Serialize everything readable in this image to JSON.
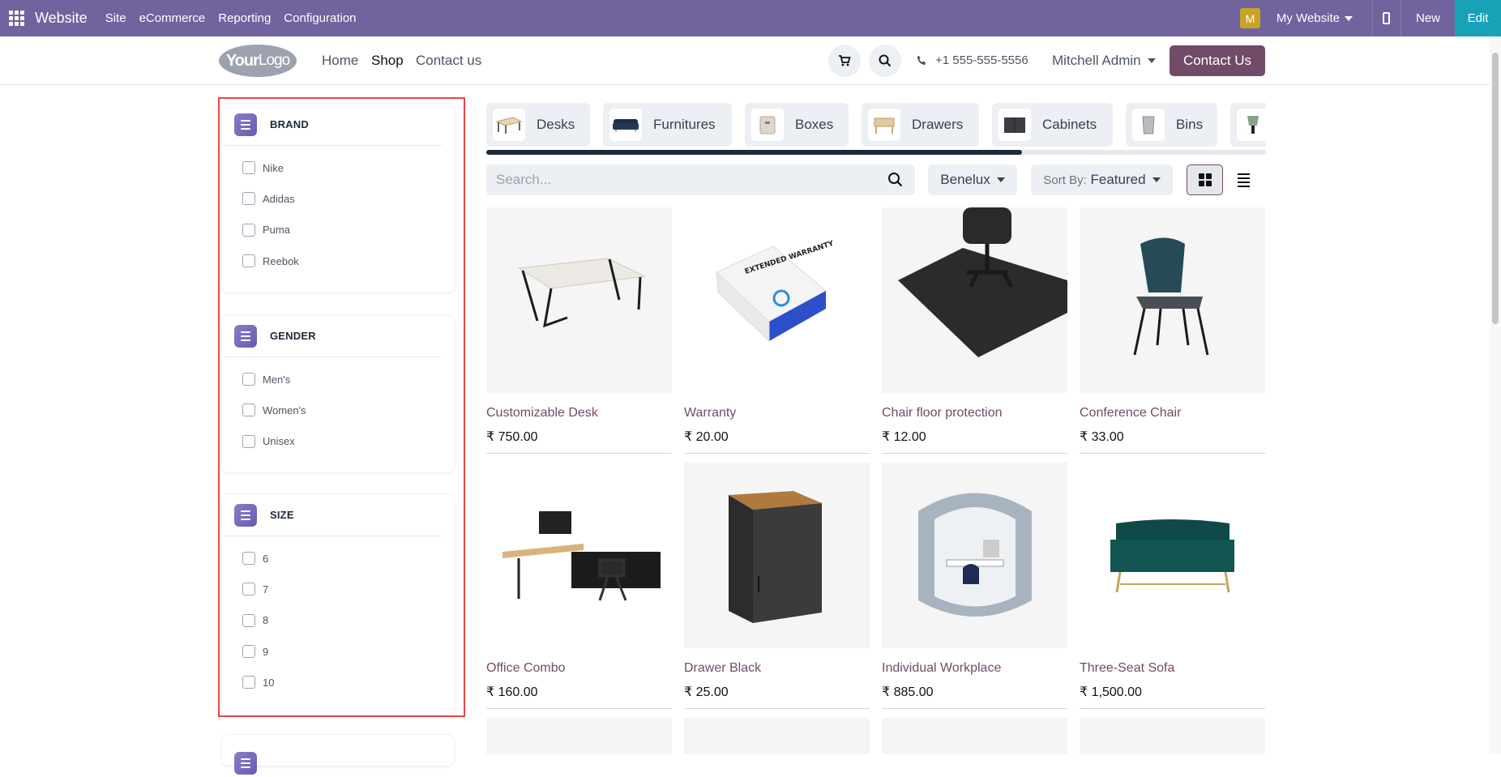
{
  "topbar": {
    "app_name": "Website",
    "menu": [
      "Site",
      "eCommerce",
      "Reporting",
      "Configuration"
    ],
    "avatar_letter": "M",
    "website_selector": "My Website",
    "new_label": "New",
    "edit_label": "Edit",
    "colors": {
      "bar": "#71639e",
      "edit": "#17a2b8"
    }
  },
  "header": {
    "logo_text": "Your",
    "logo_text2": "Logo",
    "nav": [
      "Home",
      "Shop",
      "Contact us"
    ],
    "phone": "+1 555-555-5556",
    "user": "Mitchell Admin",
    "contact_button": "Contact Us"
  },
  "filters": [
    {
      "title": "BRAND",
      "options": [
        "Nike",
        "Adidas",
        "Puma",
        "Reebok"
      ]
    },
    {
      "title": "GENDER",
      "options": [
        "Men's",
        "Women's",
        "Unisex"
      ]
    },
    {
      "title": "SIZE",
      "options": [
        "6",
        "7",
        "8",
        "9",
        "10"
      ]
    }
  ],
  "categories": [
    "Desks",
    "Furnitures",
    "Boxes",
    "Drawers",
    "Cabinets",
    "Bins"
  ],
  "toolbar": {
    "search_placeholder": "Search...",
    "pricelist": "Benelux",
    "sort_prefix": "Sort By:",
    "sort_value": "Featured"
  },
  "products": [
    {
      "name": "Customizable Desk",
      "price": "₹ 750.00"
    },
    {
      "name": "Warranty",
      "price": "₹ 20.00"
    },
    {
      "name": "Chair floor protection",
      "price": "₹ 12.00"
    },
    {
      "name": "Conference Chair",
      "price": "₹ 33.00"
    },
    {
      "name": "Office Combo",
      "price": "₹ 160.00"
    },
    {
      "name": "Drawer Black",
      "price": "₹ 25.00"
    },
    {
      "name": "Individual Workplace",
      "price": "₹ 885.00"
    },
    {
      "name": "Three-Seat Sofa",
      "price": "₹ 1,500.00"
    }
  ],
  "warranty_box_text": "EXTENDED WARRANTY"
}
